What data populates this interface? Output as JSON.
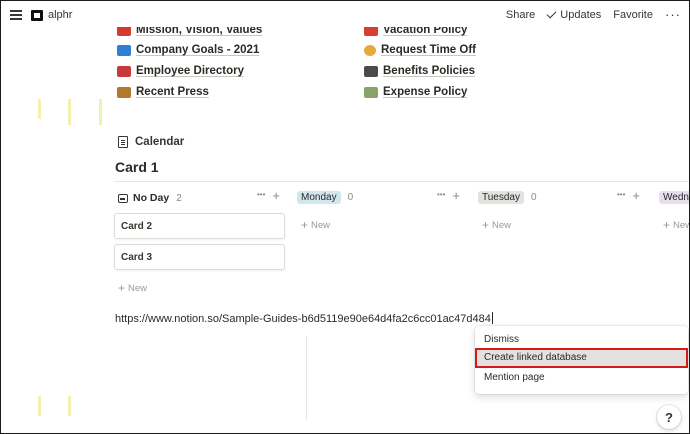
{
  "topbar": {
    "page_name": "alphr",
    "share": "Share",
    "updates": "Updates",
    "favorite": "Favorite"
  },
  "links_left": [
    {
      "label": "Mission, Vision, Values",
      "icon": "red-flag-icon"
    },
    {
      "label": "Company Goals - 2021",
      "icon": "truck-icon"
    },
    {
      "label": "Employee Directory",
      "icon": "telephone-icon"
    },
    {
      "label": "Recent Press",
      "icon": "megaphone-icon"
    }
  ],
  "links_right": [
    {
      "label": "Vacation Policy",
      "icon": "vehicle-icon"
    },
    {
      "label": "Request Time Off",
      "icon": "face-icon"
    },
    {
      "label": "Benefits Policies",
      "icon": "coffee-icon"
    },
    {
      "label": "Expense Policy",
      "icon": "money-icon"
    }
  ],
  "calendar_label": "Calendar",
  "card_title": "Card 1",
  "board": {
    "columns": [
      {
        "label": "No Day",
        "count": "2",
        "color": "#ffffff"
      },
      {
        "label": "Monday",
        "count": "0",
        "color": "#d3e5ef"
      },
      {
        "label": "Tuesday",
        "count": "0",
        "color": "#e3e2e0"
      },
      {
        "label": "Wedne",
        "color": "#e8deee"
      }
    ],
    "cards": [
      "Card 2",
      "Card 3"
    ],
    "new_label": "New",
    "dots": "•••",
    "plus": "+"
  },
  "url_text": "https://www.notion.so/Sample-Guides-b6d5119e90e64d4fa2c6cc01ac47d484",
  "dropdown": {
    "items": [
      "Dismiss",
      "Create linked database",
      "Mention page"
    ]
  },
  "help_label": "?",
  "colors": {
    "highlight_border": "#d21c1c",
    "text": "#37352f"
  }
}
